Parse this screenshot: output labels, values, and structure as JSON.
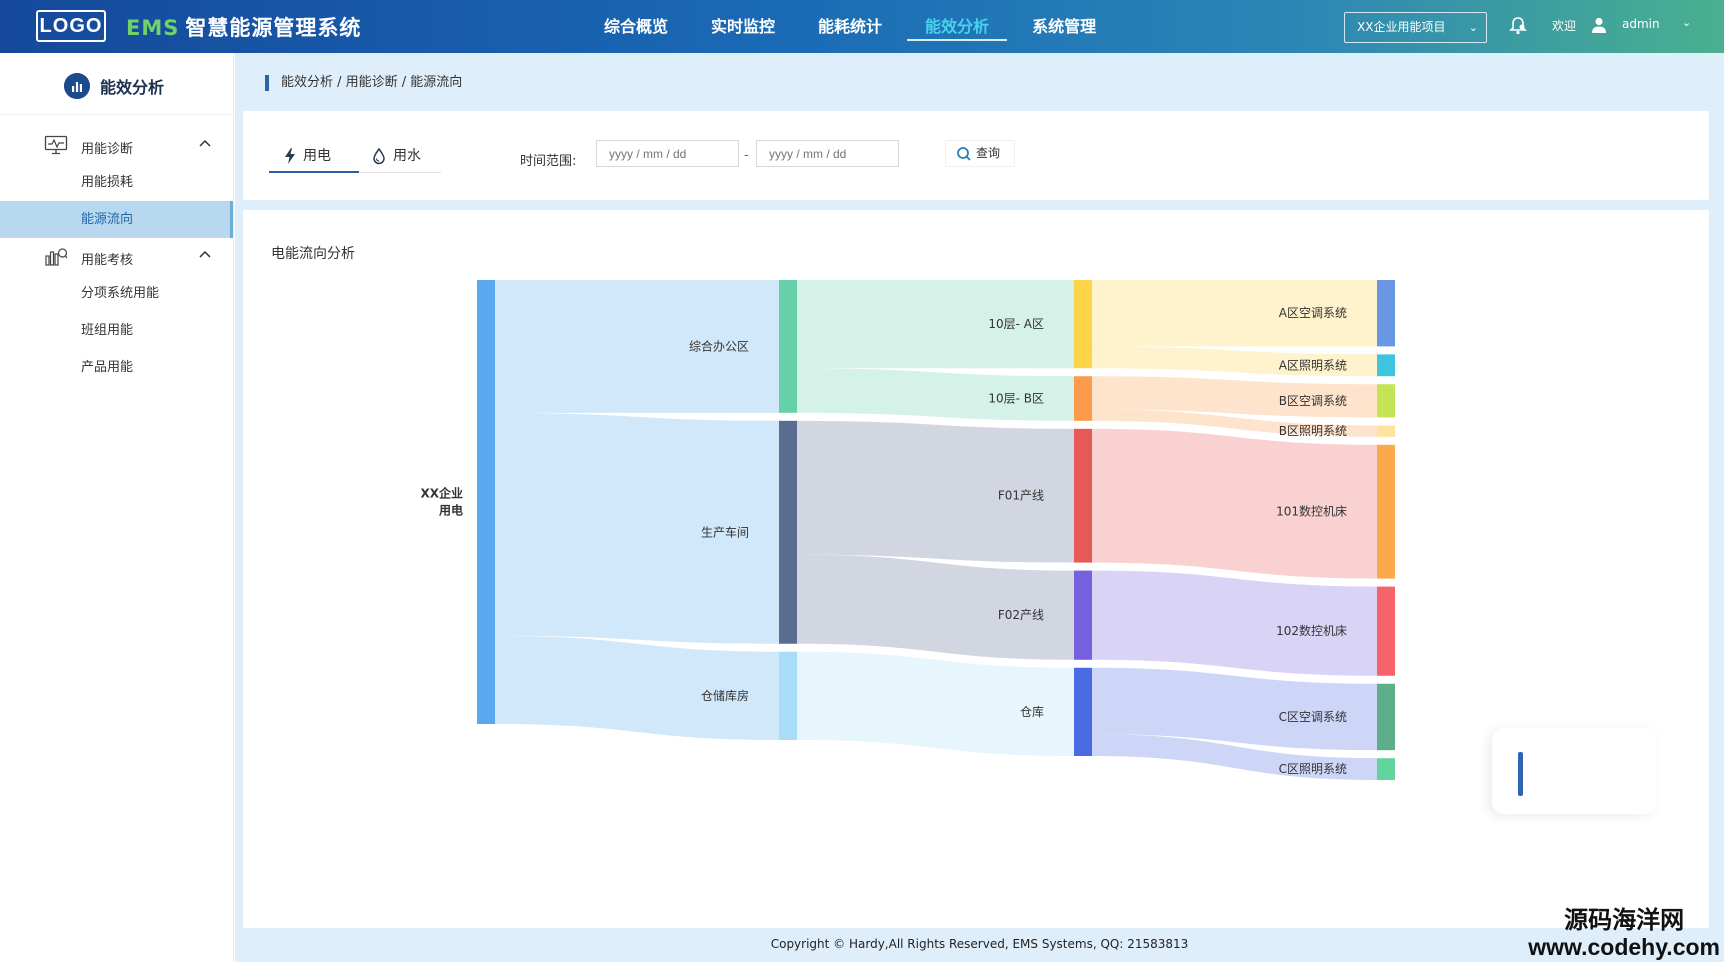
{
  "header": {
    "logo": "LOGO",
    "title_prefix": "EMS",
    "title": "智慧能源管理系统",
    "nav": [
      "综合概览",
      "实时监控",
      "能耗统计",
      "能效分析",
      "系统管理"
    ],
    "active_nav": "能效分析",
    "project_select": "XX企业用能项目",
    "welcome": "欢迎",
    "username": "admin"
  },
  "sidebar": {
    "title": "能效分析",
    "groups": [
      {
        "label": "用能诊断",
        "items": [
          "用能损耗",
          "能源流向"
        ]
      },
      {
        "label": "用能考核",
        "items": [
          "分项系统用能",
          "班组用能",
          "产品用能"
        ]
      }
    ],
    "active_item": "能源流向"
  },
  "breadcrumb": "能效分析 / 用能诊断 / 能源流向",
  "filter": {
    "tabs": [
      "用电",
      "用水"
    ],
    "active_tab": "用电",
    "time_label": "时间范围:",
    "start_placeholder": "yyyy / mm / dd",
    "end_placeholder": "yyyy / mm / dd",
    "separator": "-",
    "query_label": "查询"
  },
  "panel": {
    "title": "电能流向分析"
  },
  "chart_data": {
    "type": "sankey",
    "title": "",
    "nodes": [
      {
        "name": "XX企业用电",
        "label_lines": [
          "XX企业",
          "用电"
        ],
        "level": 0,
        "color": "#5aa9ee"
      },
      {
        "name": "综合办公区",
        "level": 1,
        "color": "#66d1a8"
      },
      {
        "name": "生产车间",
        "level": 1,
        "color": "#5a6c8f"
      },
      {
        "name": "仓储库房",
        "level": 1,
        "color": "#a9dcf9"
      },
      {
        "name": "10层- A区",
        "level": 2,
        "color": "#fdd448"
      },
      {
        "name": "10层- B区",
        "level": 2,
        "color": "#fb9b4b"
      },
      {
        "name": "F01产线",
        "level": 2,
        "color": "#e75957"
      },
      {
        "name": "F02产线",
        "level": 2,
        "color": "#7561e0"
      },
      {
        "name": "仓库",
        "level": 2,
        "color": "#4a6ae3"
      },
      {
        "name": "A区空调系统",
        "level": 3,
        "color": "#6a97e4"
      },
      {
        "name": "A区照明系统",
        "level": 3,
        "color": "#3ec4de"
      },
      {
        "name": "B区空调系统",
        "level": 3,
        "color": "#c5e453"
      },
      {
        "name": "B区照明系统",
        "level": 3,
        "color": "#fde39d"
      },
      {
        "name": "101数控机床",
        "level": 3,
        "color": "#fca949"
      },
      {
        "name": "102数控机床",
        "level": 3,
        "color": "#f5636b"
      },
      {
        "name": "C区空调系统",
        "level": 3,
        "color": "#5caf8a"
      },
      {
        "name": "C区照明系统",
        "level": 3,
        "color": "#62d49e"
      }
    ],
    "links": [
      {
        "source": "XX企业用电",
        "target": "综合办公区",
        "value": 140
      },
      {
        "source": "XX企业用电",
        "target": "生产车间",
        "value": 235
      },
      {
        "source": "XX企业用电",
        "target": "仓储库房",
        "value": 93
      },
      {
        "source": "综合办公区",
        "target": "10层- A区",
        "value": 93
      },
      {
        "source": "综合办公区",
        "target": "10层- B区",
        "value": 47
      },
      {
        "source": "生产车间",
        "target": "F01产线",
        "value": 141
      },
      {
        "source": "生产车间",
        "target": "F02产线",
        "value": 94
      },
      {
        "source": "仓储库房",
        "target": "仓库",
        "value": 93
      },
      {
        "source": "10层- A区",
        "target": "A区空调系统",
        "value": 70
      },
      {
        "source": "10层- A区",
        "target": "A区照明系统",
        "value": 23
      },
      {
        "source": "10层- B区",
        "target": "B区空调系统",
        "value": 35
      },
      {
        "source": "10层- B区",
        "target": "B区照明系统",
        "value": 12
      },
      {
        "source": "F01产线",
        "target": "101数控机床",
        "value": 141
      },
      {
        "source": "F02产线",
        "target": "102数控机床",
        "value": 94
      },
      {
        "source": "仓库",
        "target": "C区空调系统",
        "value": 70
      },
      {
        "source": "仓库",
        "target": "C区照明系统",
        "value": 23
      }
    ]
  },
  "footer": "Copyright © Hardy,All Rights Reserved, EMS Systems, QQ: 21583813",
  "watermark": {
    "line1": "源码海洋网",
    "line2": "www.codehy.com"
  }
}
